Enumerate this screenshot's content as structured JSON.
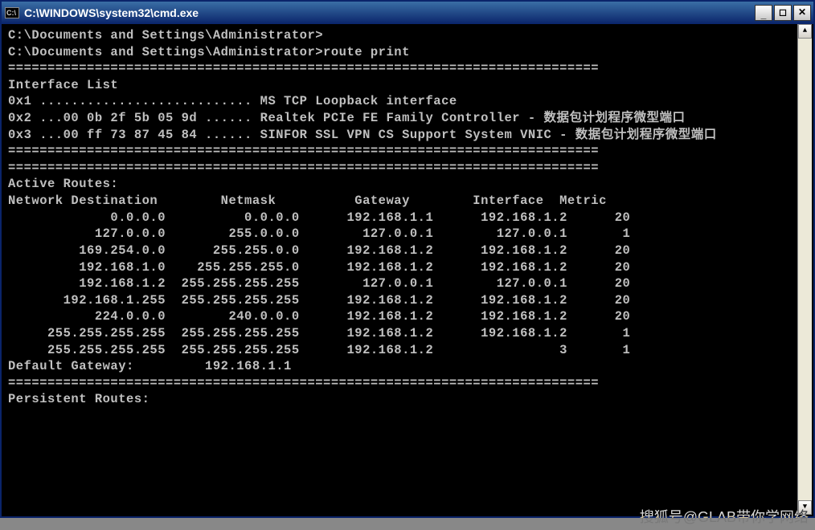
{
  "window": {
    "title": "C:\\WINDOWS\\system32\\cmd.exe",
    "icon_glyph": "C:\\"
  },
  "prompt1": "C:\\Documents and Settings\\Administrator>",
  "prompt2_cmd": "C:\\Documents and Settings\\Administrator>route print",
  "divider": "===========================================================================",
  "interface_list_header": "Interface List",
  "interfaces": [
    "0x1 ........................... MS TCP Loopback interface",
    "0x2 ...00 0b 2f 5b 05 9d ...... Realtek PCIe FE Family Controller - 数据包计划程序微型端口",
    "0x3 ...00 ff 73 87 45 84 ...... SINFOR SSL VPN CS Support System VNIC - 数据包计划程序微型端口"
  ],
  "active_routes_header": "Active Routes:",
  "route_columns": [
    "Network Destination",
    "Netmask",
    "Gateway",
    "Interface",
    "Metric"
  ],
  "routes": [
    {
      "dest": "0.0.0.0",
      "mask": "0.0.0.0",
      "gw": "192.168.1.1",
      "iface": "192.168.1.2",
      "metric": "20"
    },
    {
      "dest": "127.0.0.0",
      "mask": "255.0.0.0",
      "gw": "127.0.0.1",
      "iface": "127.0.0.1",
      "metric": "1"
    },
    {
      "dest": "169.254.0.0",
      "mask": "255.255.0.0",
      "gw": "192.168.1.2",
      "iface": "192.168.1.2",
      "metric": "20"
    },
    {
      "dest": "192.168.1.0",
      "mask": "255.255.255.0",
      "gw": "192.168.1.2",
      "iface": "192.168.1.2",
      "metric": "20"
    },
    {
      "dest": "192.168.1.2",
      "mask": "255.255.255.255",
      "gw": "127.0.0.1",
      "iface": "127.0.0.1",
      "metric": "20"
    },
    {
      "dest": "192.168.1.255",
      "mask": "255.255.255.255",
      "gw": "192.168.1.2",
      "iface": "192.168.1.2",
      "metric": "20"
    },
    {
      "dest": "224.0.0.0",
      "mask": "240.0.0.0",
      "gw": "192.168.1.2",
      "iface": "192.168.1.2",
      "metric": "20"
    },
    {
      "dest": "255.255.255.255",
      "mask": "255.255.255.255",
      "gw": "192.168.1.2",
      "iface": "192.168.1.2",
      "metric": "1"
    },
    {
      "dest": "255.255.255.255",
      "mask": "255.255.255.255",
      "gw": "192.168.1.2",
      "iface": "3",
      "metric": "1"
    }
  ],
  "default_gateway_label": "Default Gateway:",
  "default_gateway_value": "192.168.1.1",
  "persistent_header": "Persistent Routes:",
  "watermark": "搜狐号@GLAB带你学网络",
  "col_widths": {
    "dest": 20,
    "mask": 17,
    "gw": 17,
    "iface": 17,
    "metric": 8
  },
  "scrollbar": {
    "up": "▲",
    "down": "▼"
  }
}
